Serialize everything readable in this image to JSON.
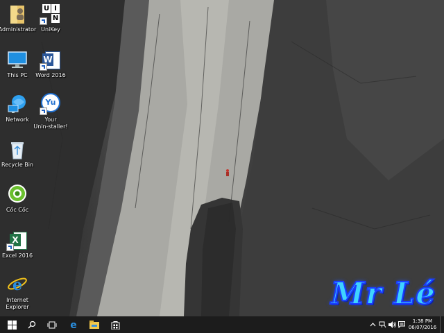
{
  "desktop": {
    "icons": [
      {
        "id": "administrator",
        "label": "Administrator"
      },
      {
        "id": "unikey",
        "label": "UniKey"
      },
      {
        "id": "this-pc",
        "label": "This PC"
      },
      {
        "id": "word-2016",
        "label": "Word 2016"
      },
      {
        "id": "network",
        "label": "Network"
      },
      {
        "id": "your-uninstaller",
        "label": "Your\nUnin-staller!"
      },
      {
        "id": "recycle-bin",
        "label": "Recycle Bin"
      },
      {
        "id": "coc-coc",
        "label": "Cốc Cốc"
      },
      {
        "id": "excel-2016",
        "label": "Excel 2016"
      },
      {
        "id": "internet-explorer",
        "label": "Internet\nExplorer"
      }
    ],
    "unikey_tile": {
      "letters": [
        "U",
        "I",
        "N"
      ]
    },
    "excel_letter": "X",
    "word_letter": "W",
    "yu_letters": "Yu",
    "watermark": "Mr Lé"
  },
  "taskbar": {
    "buttons": [
      "start-windows-icon",
      "search-icon",
      "task-view-icon",
      "edge-icon",
      "file-explorer-icon",
      "store-icon"
    ],
    "tray": [
      "chevron-up-icon",
      "network-tray-icon",
      "volume-icon",
      "notifications-icon"
    ],
    "clock": {
      "time": "1:38 PM",
      "date": "06/07/2016"
    }
  },
  "colors": {
    "taskbar": "#1c1c1c",
    "accent": "#1f8fe0",
    "watermark_fill": "#3fd3ff",
    "watermark_stroke": "#1a3cff"
  }
}
